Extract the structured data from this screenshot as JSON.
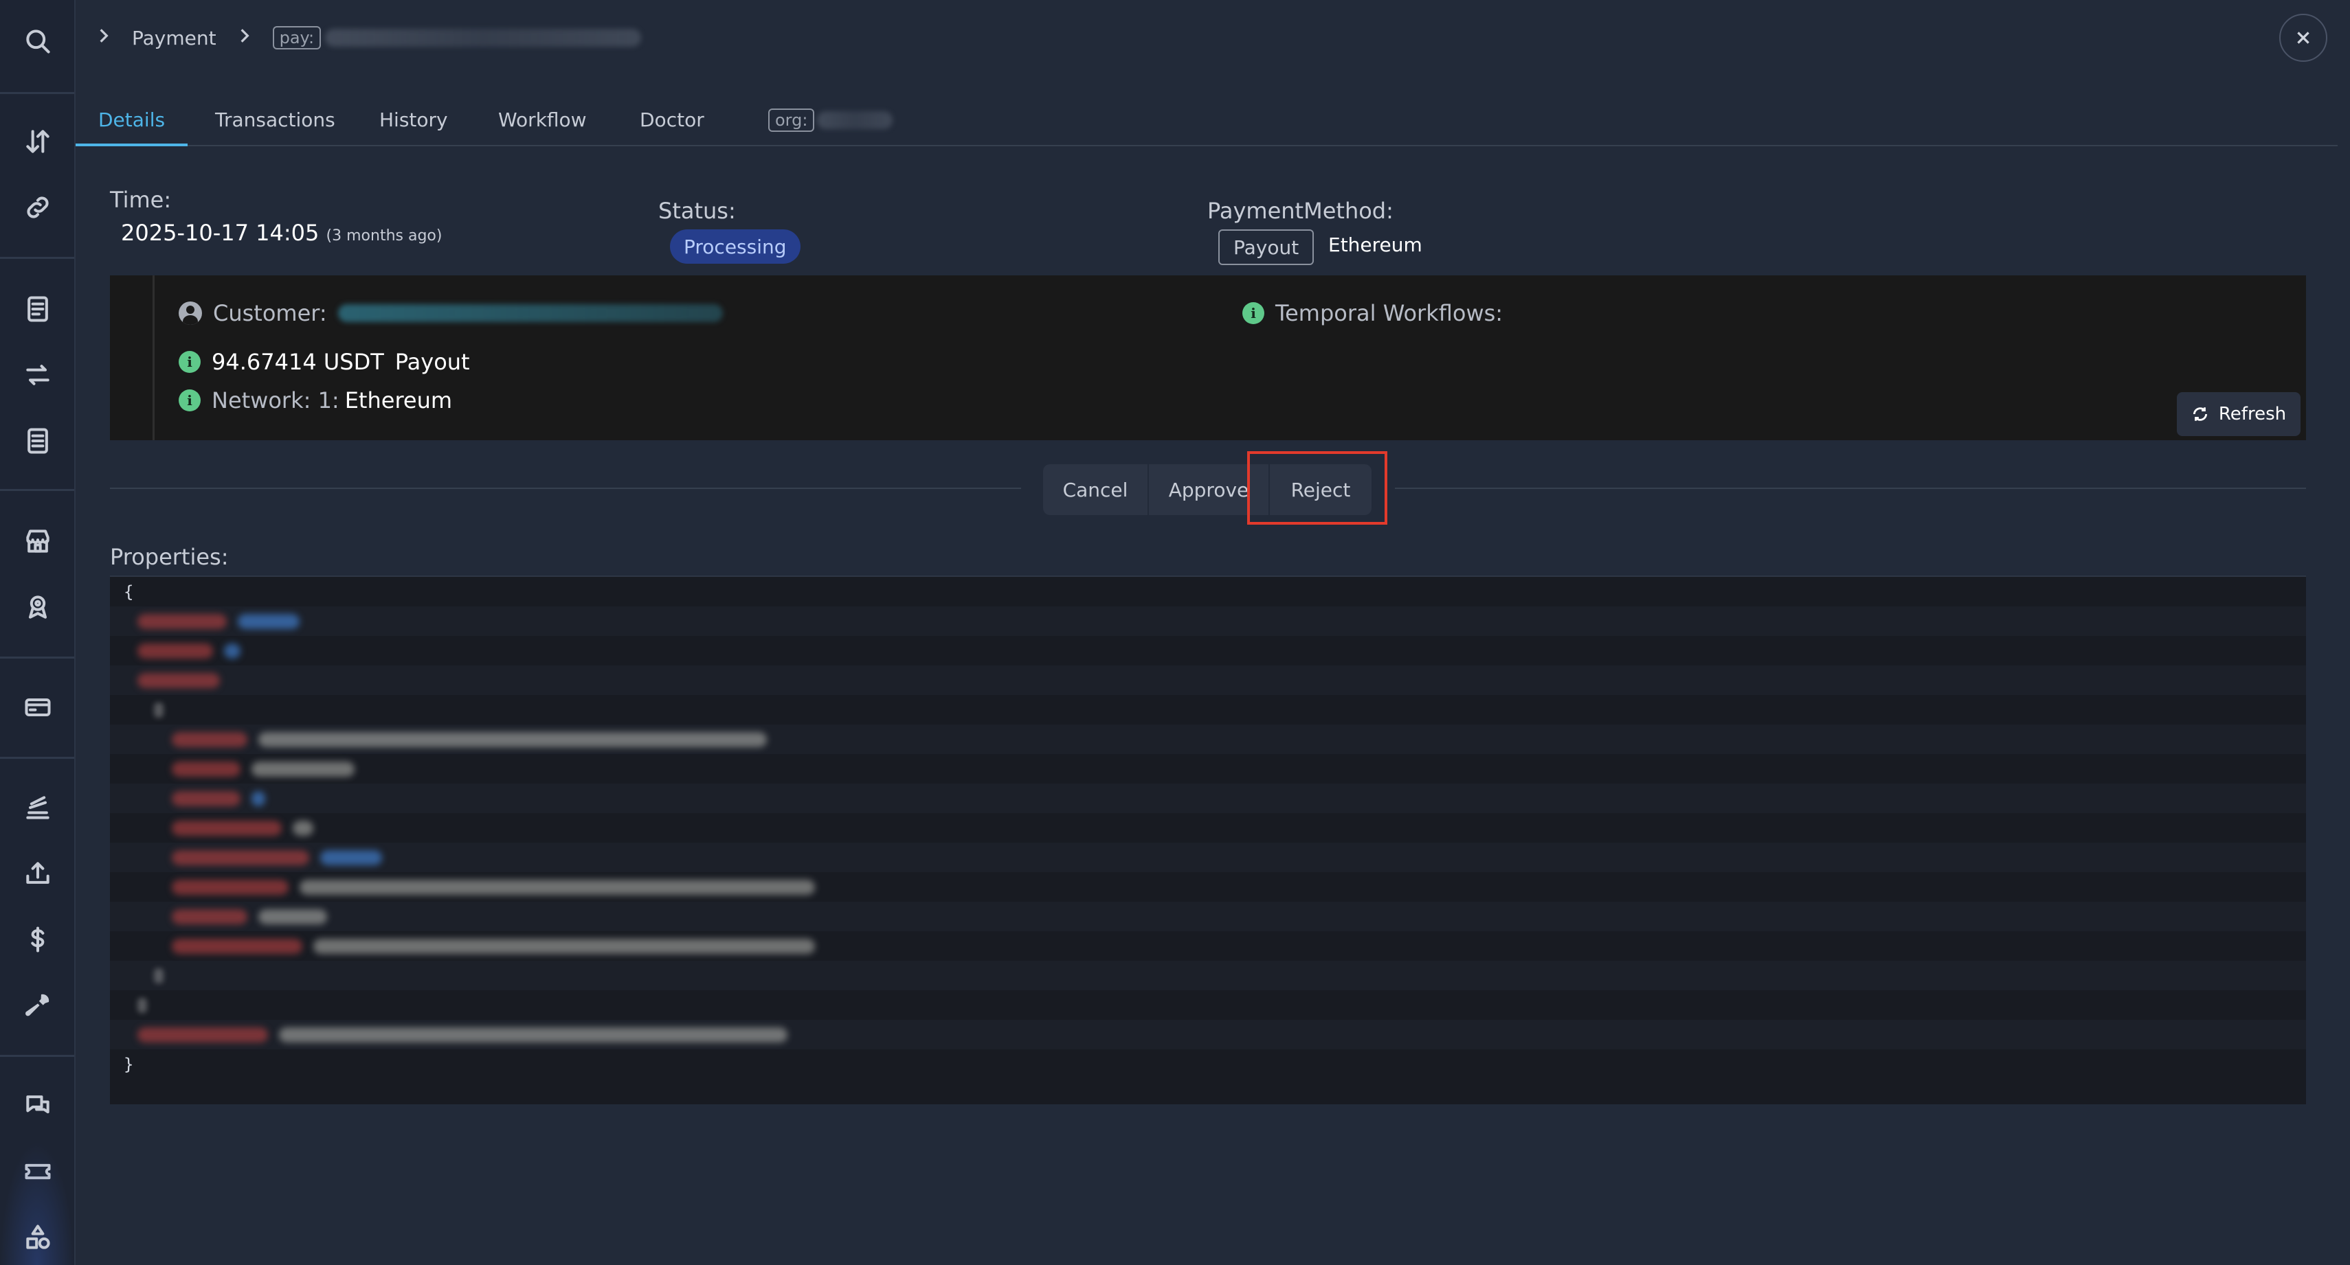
{
  "breadcrumb": {
    "root": "Payment",
    "id_prefix": "pay:"
  },
  "tabs": [
    {
      "label": "Details",
      "active": true
    },
    {
      "label": "Transactions"
    },
    {
      "label": "History"
    },
    {
      "label": "Workflow"
    },
    {
      "label": "Doctor"
    },
    {
      "label": "org:"
    }
  ],
  "summary": {
    "time_label": "Time:",
    "time_value": "2025-10-17 14:05",
    "time_relative": "(3 months ago)",
    "status_label": "Status:",
    "status_value": "Processing",
    "method_label": "PaymentMethod:",
    "method_tag": "Payout",
    "method_value": "Ethereum"
  },
  "panel": {
    "customer_label": "Customer:",
    "amount": "94.67414 USDT",
    "amount_kind": "Payout",
    "network_label": "Network: 1:",
    "network_value": "Ethereum",
    "workflows_label": "Temporal Workflows:",
    "refresh_label": "Refresh"
  },
  "actions": {
    "cancel": "Cancel",
    "approve": "Approve",
    "reject": "Reject"
  },
  "properties": {
    "label": "Properties:",
    "open_brace": "{",
    "close_brace": "}"
  },
  "colors": {
    "accent": "#4eb5e8",
    "status_bg": "#263e8c",
    "info_icon": "#5fc98a",
    "highlight": "#e23a2c"
  }
}
